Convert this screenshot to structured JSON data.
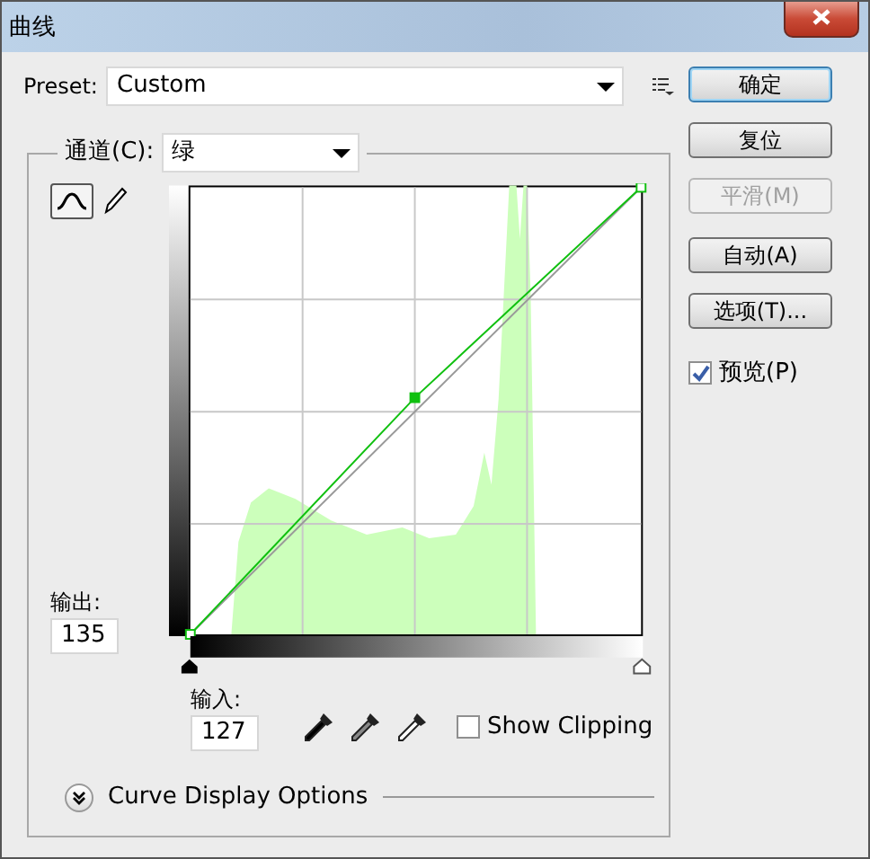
{
  "window": {
    "title": "曲线"
  },
  "preset": {
    "label": "Preset:",
    "value": "Custom"
  },
  "channel": {
    "label": "通道(C):",
    "value": "绿"
  },
  "tools": [
    {
      "kind": "curve",
      "selected": true
    },
    {
      "kind": "pencil",
      "selected": false
    }
  ],
  "output": {
    "label": "输出:",
    "value": "135"
  },
  "input": {
    "label": "输入:",
    "value": "127"
  },
  "show_clipping": {
    "label": "Show Clipping",
    "checked": false
  },
  "curve_display_options": {
    "label": "Curve Display Options",
    "expanded": false
  },
  "buttons": [
    {
      "label": "确定",
      "default": true,
      "disabled": false
    },
    {
      "label": "复位",
      "default": false,
      "disabled": false
    },
    {
      "label": "平滑(M)",
      "default": false,
      "disabled": true
    },
    {
      "label": "自动(A)",
      "default": false,
      "disabled": false
    },
    {
      "label": "选项(T)...",
      "default": false,
      "disabled": false
    }
  ],
  "preview": {
    "label": "预览(P)",
    "checked": true
  }
}
